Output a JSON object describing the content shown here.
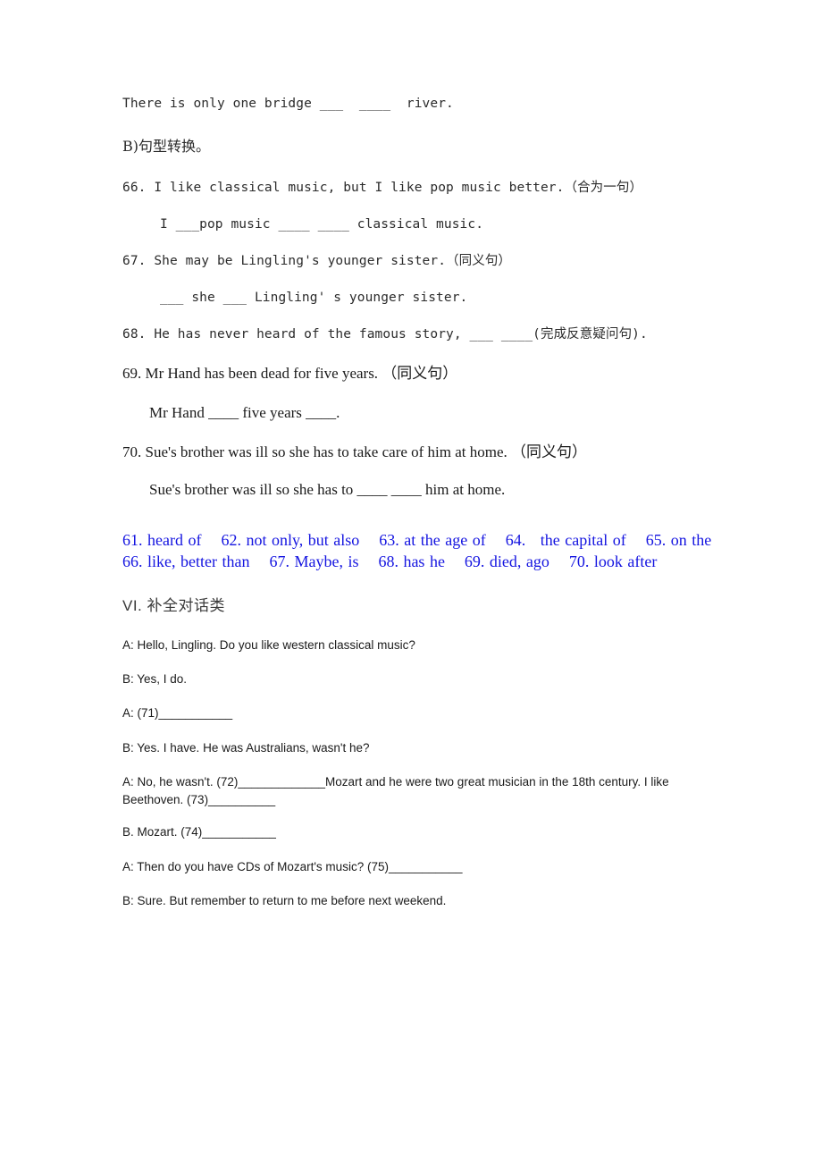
{
  "document": {
    "colors": {
      "answer_blue": "#1414e0",
      "body_text": "#1a1a1a",
      "heading_gray": "#3a3a3a",
      "page_background": "#ffffff"
    },
    "exercise_b": {
      "carryover_line": "There is only one bridge ___  ____  river.",
      "section_label": "B)句型转换。",
      "items": [
        {
          "number": "66.",
          "prompt": "66. I like classical music, but I like pop music better.（合为一句）",
          "answer_line": "I ___pop music ____ ____ classical music."
        },
        {
          "number": "67.",
          "prompt": "67. She may be Lingling's younger sister.（同义句）",
          "answer_line": "___ she ___ Lingling' s younger sister."
        },
        {
          "number": "68.",
          "prompt": "68. He has never heard of the famous story, ___ ____(完成反意疑问句).",
          "answer_line": ""
        },
        {
          "number": "69.",
          "prompt": "69. Mr Hand has been dead for five years. （同义句）",
          "answer_line": "Mr Hand ____ five years ____."
        },
        {
          "number": "70.",
          "prompt": "70. Sue's brother was ill so she has to take care of him at home. （同义句）",
          "answer_line": "Sue's brother was ill so she has to ____ ____ him at home."
        }
      ]
    },
    "answer_key": {
      "text": "61. heard of    62. not only, but also    63. at the age of    64.   the capital of    65. on the    66. like, better than    67. Maybe, is    68. has he    69. died, ago    70. look after",
      "entries": [
        {
          "number": "61.",
          "answer": "heard of"
        },
        {
          "number": "62.",
          "answer": "not only, but also"
        },
        {
          "number": "63.",
          "answer": "at the age of"
        },
        {
          "number": "64.",
          "answer": "the capital of"
        },
        {
          "number": "65.",
          "answer": "on the"
        },
        {
          "number": "66.",
          "answer": "like, better than"
        },
        {
          "number": "67.",
          "answer": "Maybe, is"
        },
        {
          "number": "68.",
          "answer": "has he"
        },
        {
          "number": "69.",
          "answer": "died, ago"
        },
        {
          "number": "70.",
          "answer": "look after"
        }
      ]
    },
    "section_six": {
      "heading": "VI. 补全对话类",
      "dialogue": [
        {
          "speaker": "A",
          "line": "A: Hello, Lingling. Do you like western classical music?"
        },
        {
          "speaker": "B",
          "line": "B: Yes, I do."
        },
        {
          "speaker": "A",
          "line": "A: (71)___________"
        },
        {
          "speaker": "B",
          "line": "B: Yes. I have. He was Australians, wasn't he?"
        },
        {
          "speaker": "A",
          "line": "A: No, he wasn't. (72)_____________Mozart and he were two great musician in the 18th century. I like Beethoven. (73)__________"
        },
        {
          "speaker": "B",
          "line": "B. Mozart. (74)___________"
        },
        {
          "speaker": "A",
          "line": "A: Then do you have CDs of Mozart's music? (75)___________"
        },
        {
          "speaker": "B",
          "line": "B: Sure. But remember to return to me before next weekend."
        }
      ]
    }
  }
}
